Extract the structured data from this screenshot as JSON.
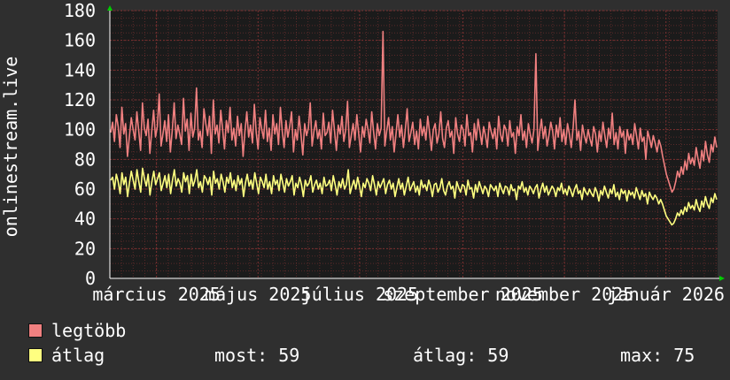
{
  "chart_data": {
    "type": "line",
    "ylabel": "onlinestream.live",
    "ylim": [
      0,
      180
    ],
    "yticks": [
      0,
      20,
      40,
      60,
      80,
      100,
      120,
      140,
      160,
      180
    ],
    "xticks": [
      "március 2025",
      "május 2025",
      "július 2025",
      "szeptember 2025",
      "november 2025",
      "január 2026"
    ],
    "grid": true,
    "x_range_days": [
      0,
      365
    ],
    "xtick_days": [
      28,
      89,
      150,
      212,
      273,
      334
    ],
    "series": [
      {
        "name": "legtöbb",
        "color": "#f08080",
        "values": [
          98,
          105,
          92,
          110,
          102,
          88,
          115,
          97,
          104,
          82,
          95,
          108,
          100,
          93,
          112,
          99,
          86,
          118,
          101,
          96,
          107,
          84,
          99,
          113,
          95,
          102,
          124,
          89,
          97,
          106,
          92,
          110,
          85,
          100,
          118,
          94,
          103,
          97,
          90,
          121,
          99,
          107,
          86,
          111,
          95,
          101,
          128,
          93,
          99,
          88,
          114,
          104,
          96,
          109,
          84,
          120,
          97,
          103,
          91,
          113,
          100,
          87,
          106,
          98,
          115,
          93,
          101,
          89,
          109,
          96,
          104,
          82,
          99,
          112,
          95,
          103,
          91,
          117,
          98,
          87,
          108,
          100,
          94,
          113,
          92,
          101,
          86,
          110,
          97,
          104,
          90,
          115,
          99,
          88,
          106,
          95,
          102,
          112,
          85,
          100,
          93,
          109,
          97,
          83,
          104,
          96,
          101,
          118,
          89,
          99,
          106,
          94,
          100,
          87,
          111,
          96,
          98,
          105,
          91,
          113,
          99,
          86,
          103,
          97,
          109,
          92,
          100,
          119,
          88,
          96,
          104,
          93,
          110,
          97,
          85,
          102,
          95,
          107,
          100,
          91,
          112,
          98,
          87,
          104,
          96,
          101,
          166,
          89,
          99,
          108,
          93,
          102,
          85,
          97,
          110,
          95,
          103,
          88,
          100,
          114,
          92,
          98,
          105,
          90,
          99,
          87,
          107,
          96,
          102,
          93,
          109,
          98,
          86,
          100,
          104,
          91,
          97,
          112,
          94,
          88,
          101,
          106,
          95,
          99,
          84,
          108,
          97,
          92,
          103,
          100,
          89,
          110,
          96,
          98,
          85,
          104,
          93,
          107,
          99,
          90,
          102,
          96,
          88,
          105,
          99,
          94,
          101,
          87,
          109,
          97,
          92,
          103,
          100,
          89,
          106,
          95,
          98,
          84,
          102,
          96,
          110,
          93,
          99,
          88,
          104,
          97,
          91,
          100,
          151,
          86,
          98,
          107,
          94,
          102,
          89,
          96,
          105,
          99,
          87,
          103,
          95,
          108,
          92,
          100,
          90,
          104,
          97,
          88,
          101,
          120,
          93,
          99,
          86,
          103,
          96,
          91,
          100,
          94,
          89,
          102,
          97,
          85,
          99,
          92,
          105,
          96,
          88,
          101,
          94,
          111,
          90,
          98,
          87,
          102,
          95,
          99,
          84,
          100,
          93,
          97,
          90,
          104,
          96,
          87,
          101,
          92,
          95,
          80,
          99,
          94,
          88,
          96,
          91,
          85,
          93,
          89,
          82,
          76,
          70,
          66,
          62,
          58,
          60,
          65,
          72,
          68,
          75,
          70,
          79,
          73,
          84,
          77,
          81,
          76,
          88,
          80,
          74,
          86,
          79,
          92,
          83,
          78,
          90,
          85,
          95,
          88
        ]
      },
      {
        "name": "átlag",
        "color": "#ffff80",
        "values": [
          66,
          68,
          60,
          70,
          65,
          57,
          71,
          63,
          68,
          55,
          64,
          72,
          66,
          60,
          73,
          65,
          58,
          74,
          67,
          62,
          70,
          56,
          65,
          72,
          63,
          67,
          71,
          59,
          64,
          69,
          61,
          70,
          57,
          66,
          73,
          62,
          67,
          64,
          58,
          71,
          65,
          69,
          57,
          70,
          62,
          66,
          73,
          61,
          65,
          58,
          69,
          67,
          63,
          68,
          56,
          72,
          64,
          67,
          60,
          70,
          65,
          58,
          68,
          64,
          71,
          61,
          66,
          59,
          69,
          63,
          67,
          55,
          64,
          70,
          62,
          66,
          60,
          71,
          64,
          57,
          68,
          65,
          61,
          70,
          60,
          65,
          57,
          69,
          63,
          66,
          59,
          70,
          64,
          58,
          67,
          62,
          65,
          69,
          56,
          64,
          61,
          68,
          63,
          55,
          66,
          62,
          64,
          69,
          58,
          63,
          66,
          60,
          64,
          57,
          68,
          62,
          63,
          66,
          59,
          69,
          63,
          56,
          65,
          61,
          67,
          60,
          63,
          73,
          57,
          62,
          66,
          60,
          68,
          62,
          55,
          64,
          61,
          67,
          64,
          59,
          69,
          63,
          56,
          65,
          61,
          64,
          67,
          57,
          63,
          66,
          60,
          64,
          55,
          61,
          67,
          60,
          64,
          56,
          62,
          68,
          59,
          62,
          65,
          58,
          62,
          56,
          66,
          61,
          63,
          59,
          66,
          62,
          55,
          63,
          64,
          58,
          61,
          67,
          59,
          56,
          62,
          65,
          60,
          62,
          54,
          65,
          61,
          58,
          63,
          62,
          56,
          66,
          60,
          61,
          54,
          63,
          58,
          65,
          61,
          57,
          62,
          60,
          55,
          63,
          61,
          59,
          62,
          55,
          64,
          60,
          57,
          62,
          61,
          56,
          63,
          59,
          60,
          53,
          62,
          60,
          65,
          58,
          61,
          56,
          62,
          60,
          57,
          61,
          63,
          54,
          60,
          64,
          58,
          62,
          56,
          59,
          62,
          60,
          55,
          61,
          59,
          64,
          57,
          60,
          56,
          62,
          59,
          55,
          60,
          63,
          57,
          59,
          53,
          61,
          58,
          56,
          60,
          57,
          55,
          61,
          58,
          52,
          59,
          56,
          62,
          58,
          54,
          60,
          57,
          63,
          55,
          58,
          53,
          60,
          57,
          59,
          52,
          59,
          56,
          58,
          54,
          61,
          57,
          53,
          59,
          55,
          57,
          50,
          58,
          55,
          53,
          56,
          54,
          50,
          53,
          50,
          46,
          42,
          40,
          38,
          36,
          37,
          40,
          44,
          42,
          46,
          43,
          48,
          45,
          51,
          47,
          49,
          46,
          53,
          48,
          45,
          52,
          48,
          55,
          50,
          47,
          54,
          51,
          57,
          53
        ]
      }
    ]
  },
  "legend": {
    "items": [
      {
        "label": "legtöbb",
        "color": "#f08080"
      },
      {
        "label": "átlag",
        "color": "#ffff80"
      }
    ]
  },
  "stats": {
    "current": "most: 59",
    "average": "átlag: 59",
    "max": "max: 75"
  }
}
